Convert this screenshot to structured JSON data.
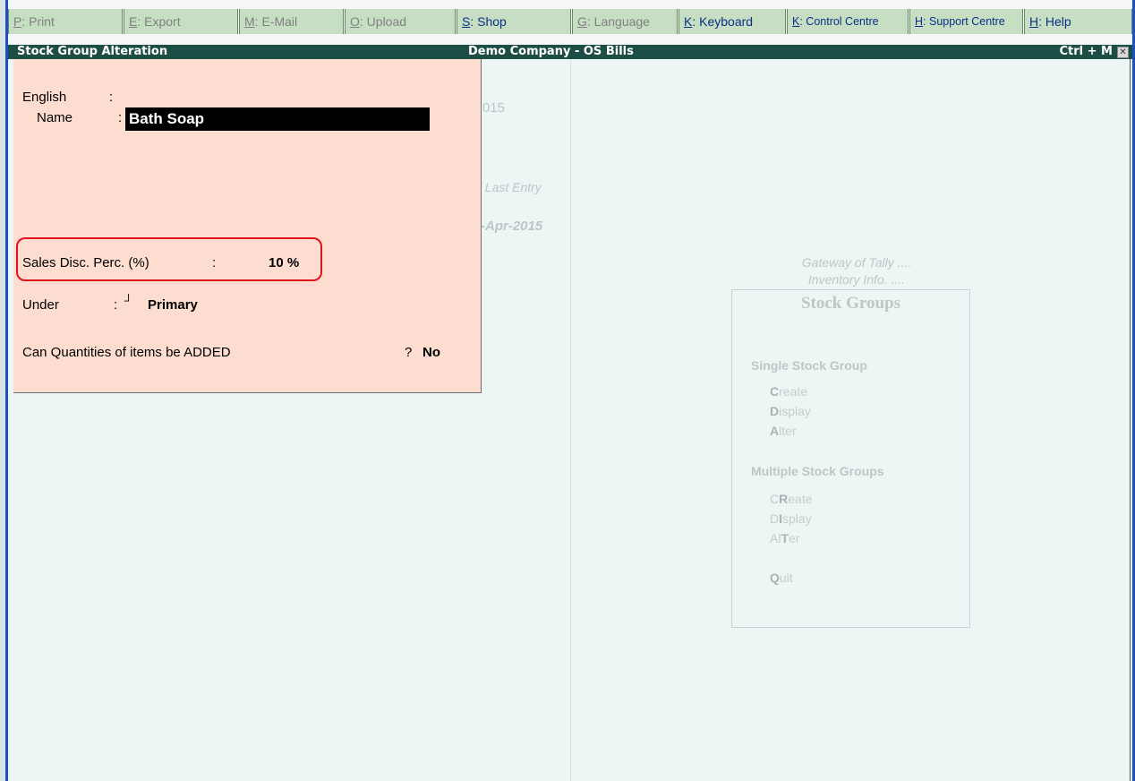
{
  "topbar": {
    "buttons": [
      {
        "key": "P",
        "label": ": Print",
        "state": "disabled"
      },
      {
        "key": "E",
        "label": ": Export",
        "state": "disabled"
      },
      {
        "key": "M",
        "label": ": E-Mail",
        "state": "disabled"
      },
      {
        "key": "O",
        "label": ": Upload",
        "state": "disabled"
      },
      {
        "key": "S",
        "label": ": Shop",
        "state": "enabled"
      },
      {
        "key": "G",
        "label": ": Language",
        "state": "disabled"
      },
      {
        "key": "K",
        "label": ": Keyboard",
        "state": "enabled"
      },
      {
        "key": "K",
        "label": ": Control Centre",
        "state": "enabled"
      },
      {
        "key": "H",
        "label": ": Support Centre",
        "state": "enabled"
      },
      {
        "key": "H",
        "label": ": Help",
        "state": "enabled"
      }
    ]
  },
  "titlebar": {
    "left": "Stock Group Alteration",
    "center": "Demo Company - OS Bills",
    "right": "Ctrl + M",
    "close_icon": "✕"
  },
  "background": {
    "partial_1": "015",
    "partial_2": "f Last Entry",
    "partial_3": "-Apr-2015"
  },
  "gateway": {
    "caption1": "Gateway of Tally ....",
    "caption2": "Inventory Info. ....",
    "title": "Stock Groups",
    "single_head": "Single Stock Group",
    "single_items": [
      {
        "hk": "C",
        "rest": "reate"
      },
      {
        "hk": "D",
        "rest": "isplay"
      },
      {
        "hk": "A",
        "rest": "lter"
      }
    ],
    "multi_head": "Multiple Stock Groups",
    "multi_items": [
      {
        "pre": "C",
        "hk": "R",
        "rest": "eate"
      },
      {
        "pre": "D",
        "hk": "I",
        "rest": "splay"
      },
      {
        "pre": "Al",
        "hk": "T",
        "rest": "er"
      }
    ],
    "quit": {
      "hk": "Q",
      "rest": "uit"
    }
  },
  "form": {
    "english_label": "English",
    "colon": ":",
    "name_label": "Name",
    "name_value": "Bath Soap",
    "disc_label": "Sales Disc. Perc. (%)",
    "disc_value": "10 %",
    "under_label": "Under",
    "under_marker": "┘",
    "under_value": "Primary",
    "qty_label": "Can Quantities of items be ADDED",
    "qty_q": "?",
    "qty_value": "No"
  },
  "colors": {
    "form_bg": "#fdddd0",
    "title_bg": "#1d4e45",
    "button_bg": "#c6dfc2",
    "highlight": "#e0131b",
    "border_blue": "#1c4fc5"
  }
}
